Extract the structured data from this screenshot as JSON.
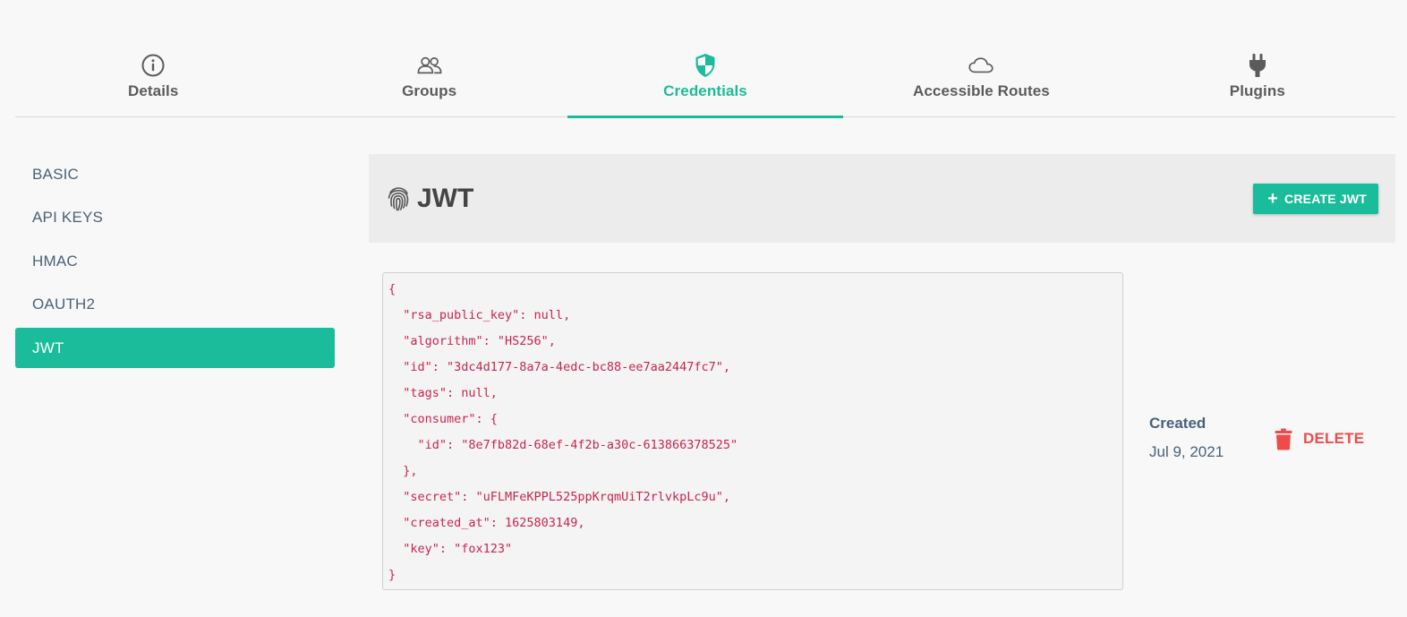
{
  "tabs": [
    {
      "label": "Details",
      "icon": "info-icon",
      "active": false
    },
    {
      "label": "Groups",
      "icon": "users-icon",
      "active": false
    },
    {
      "label": "Credentials",
      "icon": "shield-icon",
      "active": true
    },
    {
      "label": "Accessible Routes",
      "icon": "cloud-icon",
      "active": false
    },
    {
      "label": "Plugins",
      "icon": "plug-icon",
      "active": false
    }
  ],
  "sidebar": {
    "items": [
      {
        "label": "BASIC",
        "active": false
      },
      {
        "label": "API KEYS",
        "active": false
      },
      {
        "label": "HMAC",
        "active": false
      },
      {
        "label": "OAUTH2",
        "active": false
      },
      {
        "label": "JWT",
        "active": true
      }
    ]
  },
  "content": {
    "title": "JWT",
    "title_icon": "fingerprint-icon",
    "create_button": "CREATE JWT",
    "json_lines": [
      "{",
      "  \"rsa_public_key\": null,",
      "  \"algorithm\": \"HS256\",",
      "  \"id\": \"3dc4d177-8a7a-4edc-bc88-ee7aa2447fc7\",",
      "  \"tags\": null,",
      "  \"consumer\": {",
      "    \"id\": \"8e7fb82d-68ef-4f2b-a30c-613866378525\"",
      "  },",
      "  \"secret\": \"uFLMFeKPPL525ppKrqmUiT2rlvkpLc9u\",",
      "  \"created_at\": 1625803149,",
      "  \"key\": \"fox123\"",
      "}"
    ],
    "created_label": "Created",
    "created_date": "Jul 9, 2021",
    "delete_button": "DELETE"
  },
  "colors": {
    "accent": "#1bbc9b",
    "danger": "#f04b4b",
    "code": "#c7254e",
    "nav_text": "#4a6278"
  }
}
